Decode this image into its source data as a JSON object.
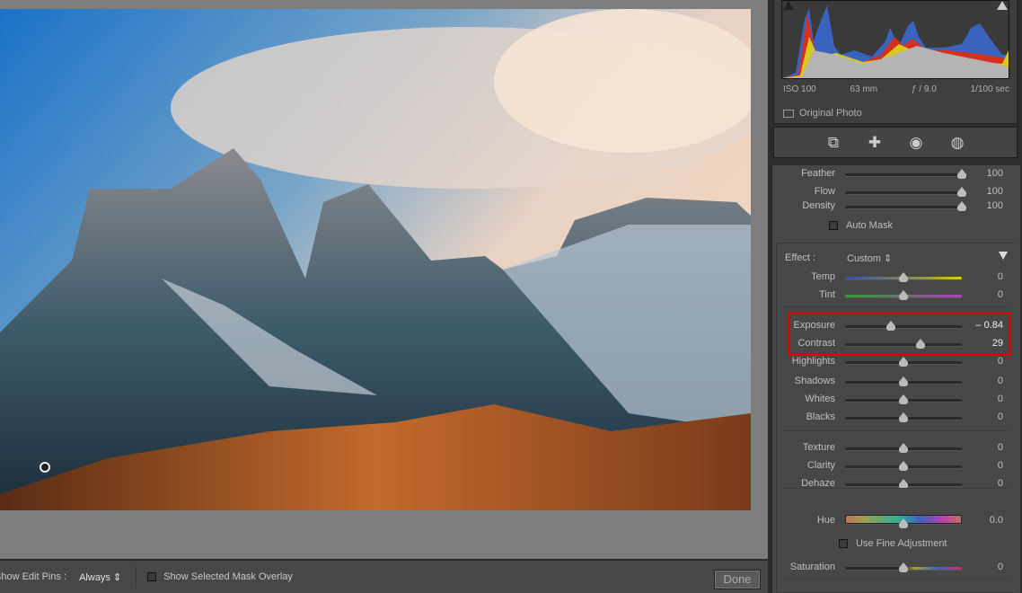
{
  "histogram": {
    "iso": "ISO 100",
    "focal_length": "63 mm",
    "aperture": "ƒ / 9.0",
    "shutter": "1/100 sec",
    "original_photo_label": "Original Photo"
  },
  "tools": [
    {
      "icon": "crop-icon",
      "glyph": "⧉"
    },
    {
      "icon": "healing-brush-icon",
      "glyph": "✚"
    },
    {
      "icon": "red-eye-icon",
      "glyph": "◉"
    },
    {
      "icon": "masking-icon",
      "glyph": "◍"
    }
  ],
  "brush": {
    "sliders": [
      {
        "label": "Feather",
        "value": "100",
        "position": 1.0
      },
      {
        "label": "Flow",
        "value": "100",
        "position": 1.0
      },
      {
        "label": "Density",
        "value": "100",
        "position": 1.0
      }
    ],
    "auto_mask_label": "Auto Mask"
  },
  "effect": {
    "label": "Effect :",
    "preset": "Custom ⇕",
    "groups": [
      [
        {
          "label": "Temp",
          "value": "0",
          "position": 0.5,
          "track": "linear-gradient(90deg,#3050b0,#9a9a40 70%,#d8d020)"
        },
        {
          "label": "Tint",
          "value": "0",
          "position": 0.5,
          "track": "linear-gradient(90deg,#30a030,#707070 50%,#b040c0)"
        }
      ],
      [
        {
          "label": "Exposure",
          "value": "– 0.84",
          "position": 0.395,
          "highlighted": true
        },
        {
          "label": "Contrast",
          "value": "29",
          "position": 0.645,
          "highlighted": true
        },
        {
          "label": "Highlights",
          "value": "0",
          "position": 0.5
        },
        {
          "label": "Shadows",
          "value": "0",
          "position": 0.5
        },
        {
          "label": "Whites",
          "value": "0",
          "position": 0.5
        },
        {
          "label": "Blacks",
          "value": "0",
          "position": 0.5
        }
      ],
      [
        {
          "label": "Texture",
          "value": "0",
          "position": 0.5
        },
        {
          "label": "Clarity",
          "value": "0",
          "position": 0.5
        },
        {
          "label": "Dehaze",
          "value": "0",
          "position": 0.5
        }
      ]
    ],
    "hue": {
      "label": "Hue",
      "value": "0.0",
      "position": 0.5
    },
    "fine_adjustment_label": "Use Fine Adjustment",
    "saturation": {
      "label": "Saturation",
      "value": "0",
      "position": 0.5
    }
  },
  "toolbar": {
    "edit_pins_label": "Show Edit Pins :",
    "edit_pins_value": "Always ⇕",
    "mask_overlay_label": "Show Selected Mask Overlay",
    "done_label": "Done"
  }
}
